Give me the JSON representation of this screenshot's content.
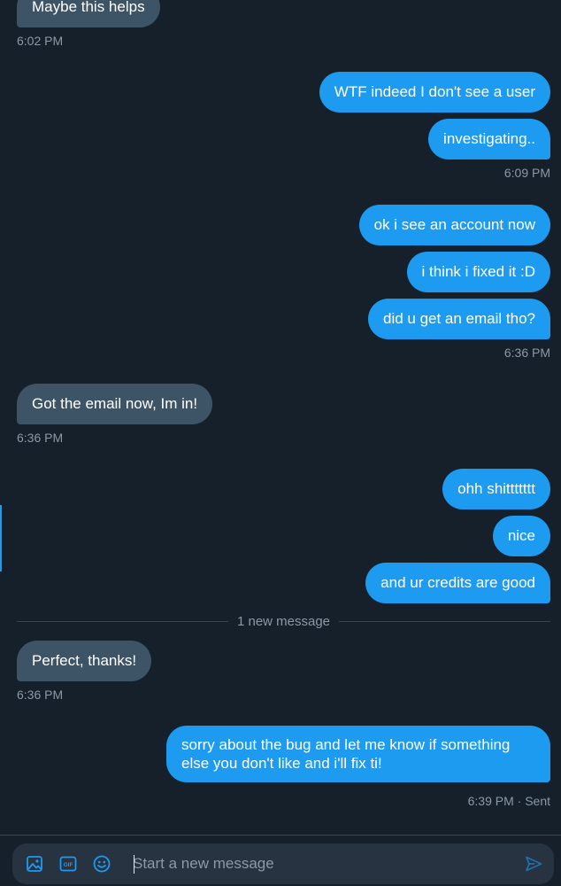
{
  "messages": {
    "m1": "Maybe this helps",
    "t1": "6:02 PM",
    "m2": "WTF indeed I don't see a user",
    "m3": "investigating..",
    "t2": "6:09 PM",
    "m4": "ok i see an account now",
    "m5": "i think i fixed it :D",
    "m6": "did u get an email tho?",
    "t3": "6:36 PM",
    "m7": "Got the email now, Im in!",
    "t4": "6:36 PM",
    "m8": "ohh shittttttt",
    "m9": "nice",
    "m10": "and ur credits are good",
    "m11": "Perfect, thanks!",
    "t5": "6:36 PM",
    "m12": "sorry about the bug and let me know if something else you don't like and i'll fix ti!",
    "t6": "6:39 PM · Sent"
  },
  "divider": {
    "label": "1 new message"
  },
  "composer": {
    "placeholder": "Start a new message",
    "icons": [
      "image-icon",
      "gif-icon",
      "emoji-icon",
      "send-icon"
    ]
  },
  "colors": {
    "background": "#15202b",
    "incoming_bubble": "#3d5466",
    "outgoing_bubble": "#1d9bf0",
    "timestamp": "#8b98a5",
    "accent": "#1d9bf0"
  }
}
